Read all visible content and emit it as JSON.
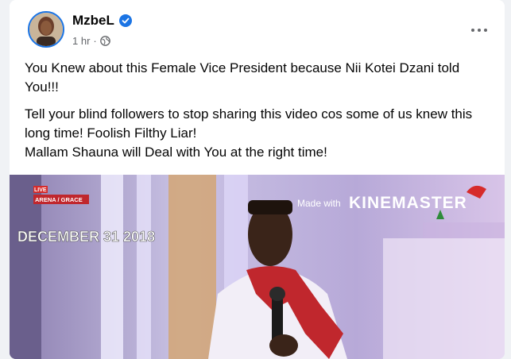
{
  "post": {
    "author": "MzbeL",
    "time": "1 hr",
    "separator": "·",
    "paragraphs": [
      "You Knew about this Female Vice President because Nii Kotei Dzani told You!!!",
      "Tell your blind followers to stop sharing this video cos some of us knew this long time! Foolish Filthy Liar!",
      "Mallam Shauna will Deal with You at the right time!"
    ]
  },
  "video": {
    "watermark_prefix": "Made with",
    "watermark_brand": "KINEMASTER",
    "date_overlay": "DECEMBER 31 2018",
    "badge_live": "LIVE",
    "badge_channel": "ARENA / GRACE"
  },
  "icons": {
    "verified": "verified-badge-icon",
    "privacy": "globe-icon",
    "menu": "more-options-icon"
  },
  "colors": {
    "brand_blue": "#1b74e4",
    "stage_red": "#c0272d"
  }
}
